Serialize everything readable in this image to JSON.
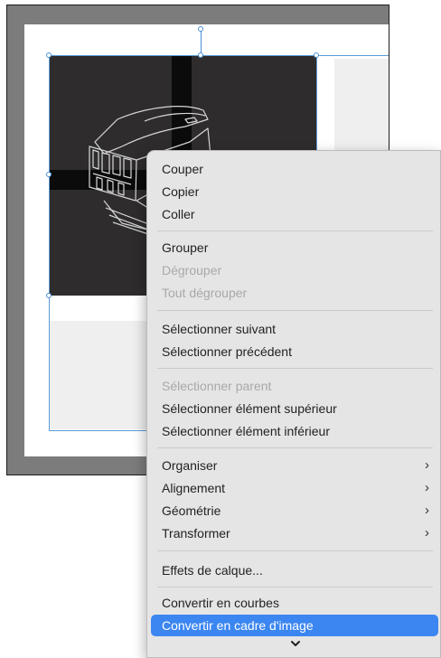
{
  "canvas": {
    "artwork_description": "dark square image with line drawing of a vintage machine"
  },
  "menu": {
    "groups": [
      [
        {
          "label": "Couper",
          "enabled": true
        },
        {
          "label": "Copier",
          "enabled": true
        },
        {
          "label": "Coller",
          "enabled": true
        }
      ],
      [
        {
          "label": "Grouper",
          "enabled": true
        },
        {
          "label": "Dégrouper",
          "enabled": false
        },
        {
          "label": "Tout dégrouper",
          "enabled": false
        }
      ],
      [
        {
          "label": "Sélectionner suivant",
          "enabled": true
        },
        {
          "label": "Sélectionner précédent",
          "enabled": true
        }
      ],
      [
        {
          "label": "Sélectionner parent",
          "enabled": false
        },
        {
          "label": "Sélectionner élément supérieur",
          "enabled": true
        },
        {
          "label": "Sélectionner élément inférieur",
          "enabled": true
        }
      ],
      [
        {
          "label": "Organiser",
          "enabled": true,
          "submenu": true
        },
        {
          "label": "Alignement",
          "enabled": true,
          "submenu": true
        },
        {
          "label": "Géométrie",
          "enabled": true,
          "submenu": true
        },
        {
          "label": "Transformer",
          "enabled": true,
          "submenu": true
        }
      ],
      [
        {
          "label": "Effets de calque...",
          "enabled": true
        }
      ],
      [
        {
          "label": "Convertir en courbes",
          "enabled": true
        },
        {
          "label": "Convertir en cadre d'image",
          "enabled": true,
          "highlighted": true
        }
      ]
    ],
    "submenu_glyph": "›",
    "more_indicator": "chevron-down-icon",
    "highlight_color": "#3b86f0"
  }
}
